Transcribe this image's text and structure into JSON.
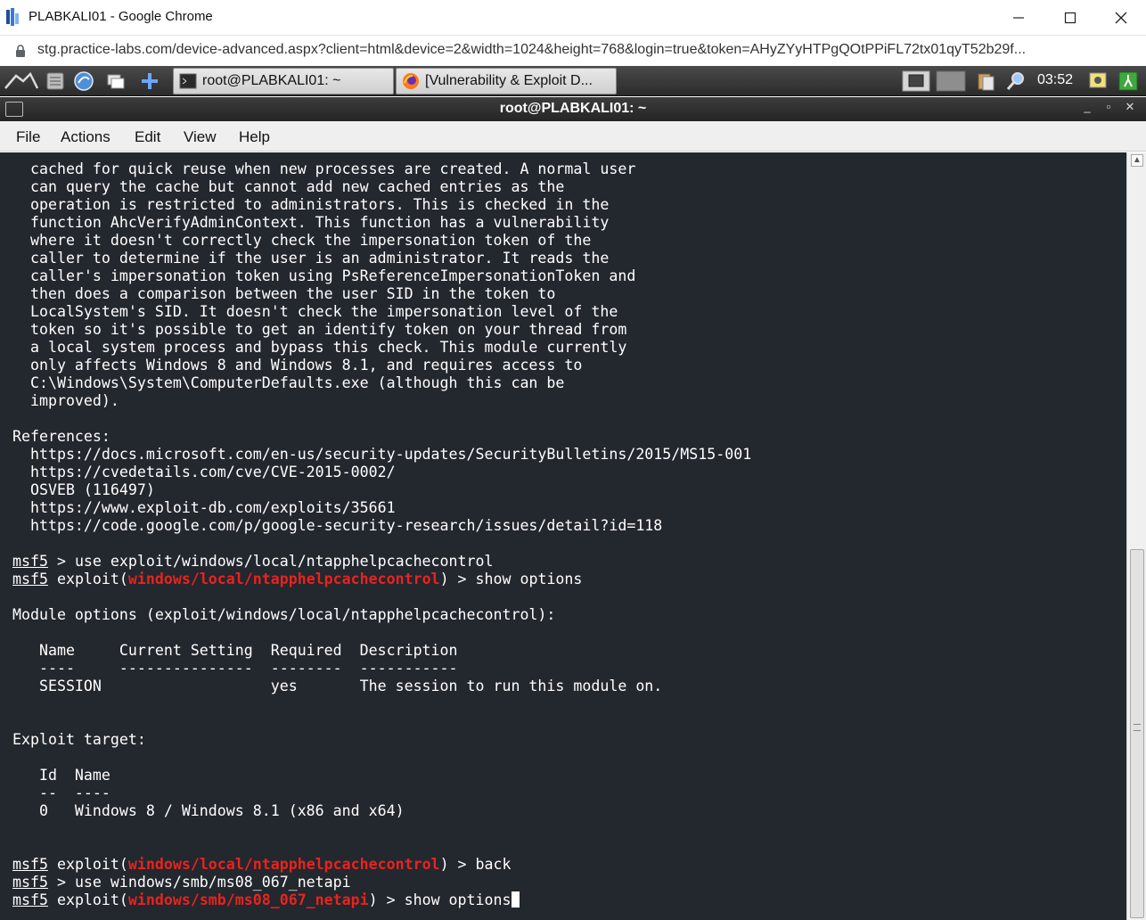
{
  "browser": {
    "window_title": "PLABKALI01 - Google Chrome",
    "url": "stg.practice-labs.com/device-advanced.aspx?client=html&device=2&width=1024&height=768&login=true&token=AHyZYyHTPgQOtPPiFL72tx01qyT52b29f..."
  },
  "panel": {
    "tasks": [
      {
        "label": "root@PLABKALI01: ~"
      },
      {
        "label": "[Vulnerability & Exploit D..."
      }
    ],
    "clock": "03:52"
  },
  "terminal": {
    "title": "root@PLABKALI01: ~",
    "menu": [
      "File",
      "Actions",
      "Edit",
      "View",
      "Help"
    ],
    "lines": [
      {
        "text": "  cached for quick reuse when new processes are created. A normal user"
      },
      {
        "text": "  can query the cache but cannot add new cached entries as the"
      },
      {
        "text": "  operation is restricted to administrators. This is checked in the"
      },
      {
        "text": "  function AhcVerifyAdminContext. This function has a vulnerability"
      },
      {
        "text": "  where it doesn't correctly check the impersonation token of the"
      },
      {
        "text": "  caller to determine if the user is an administrator. It reads the"
      },
      {
        "text": "  caller's impersonation token using PsReferenceImpersonationToken and"
      },
      {
        "text": "  then does a comparison between the user SID in the token to"
      },
      {
        "text": "  LocalSystem's SID. It doesn't check the impersonation level of the"
      },
      {
        "text": "  token so it's possible to get an identify token on your thread from"
      },
      {
        "text": "  a local system process and bypass this check. This module currently"
      },
      {
        "text": "  only affects Windows 8 and Windows 8.1, and requires access to"
      },
      {
        "text": "  C:\\Windows\\System\\ComputerDefaults.exe (although this can be"
      },
      {
        "text": "  improved)."
      },
      {
        "text": ""
      },
      {
        "text": "References:"
      },
      {
        "text": "  https://docs.microsoft.com/en-us/security-updates/SecurityBulletins/2015/MS15-001"
      },
      {
        "text": "  https://cvedetails.com/cve/CVE-2015-0002/"
      },
      {
        "text": "  OSVEB (116497)"
      },
      {
        "text": "  https://www.exploit-db.com/exploits/35661"
      },
      {
        "text": "  https://code.google.com/p/google-security-research/issues/detail?id=118"
      },
      {
        "text": ""
      },
      {
        "prompt": "msf5",
        "text": " > use exploit/windows/local/ntapphelpcachecontrol"
      },
      {
        "prompt": "msf5",
        "pre": " exploit(",
        "module": "windows/local/ntapphelpcachecontrol",
        "post": ") > show options"
      },
      {
        "text": ""
      },
      {
        "text": "Module options (exploit/windows/local/ntapphelpcachecontrol):"
      },
      {
        "text": ""
      },
      {
        "text": "   Name     Current Setting  Required  Description"
      },
      {
        "text": "   ----     ---------------  --------  -----------"
      },
      {
        "text": "   SESSION                   yes       The session to run this module on."
      },
      {
        "text": ""
      },
      {
        "text": ""
      },
      {
        "text": "Exploit target:"
      },
      {
        "text": ""
      },
      {
        "text": "   Id  Name"
      },
      {
        "text": "   --  ----"
      },
      {
        "text": "   0   Windows 8 / Windows 8.1 (x86 and x64)"
      },
      {
        "text": ""
      },
      {
        "text": ""
      },
      {
        "prompt": "msf5",
        "pre": " exploit(",
        "module": "windows/local/ntapphelpcachecontrol",
        "post": ") > back"
      },
      {
        "prompt": "msf5",
        "text": " > use windows/smb/ms08_067_netapi"
      },
      {
        "prompt": "msf5",
        "pre": " exploit(",
        "module": "windows/smb/ms08_067_netapi",
        "post": ") > show options",
        "cursor": true
      }
    ]
  },
  "colors": {
    "terminal_bg": "#23272e",
    "module_red": "#e8231e",
    "panel_bg": "#2b2b2b"
  }
}
